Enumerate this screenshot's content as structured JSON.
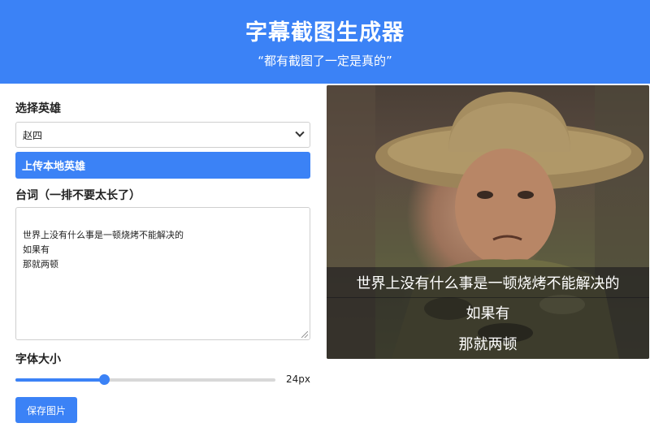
{
  "header": {
    "title": "字幕截图生成器",
    "subtitle": "“都有截图了一定是真的”"
  },
  "form": {
    "hero_label": "选择英雄",
    "hero_selected": "赵四",
    "upload_label": "上传本地英雄",
    "lines_label": "台词（一排不要太长了）",
    "lines_text": "世界上没有什么事是一顿烧烤不能解决的\n如果有\n那就两顿",
    "font_size_label": "字体大小",
    "font_size_value": "24px",
    "font_size_fraction": 0.34,
    "save_label": "保存图片"
  },
  "preview": {
    "subtitles": [
      "世界上没有什么事是一顿烧烤不能解决的",
      "如果有",
      "那就两顿"
    ]
  },
  "colors": {
    "accent": "#3b82f6"
  }
}
